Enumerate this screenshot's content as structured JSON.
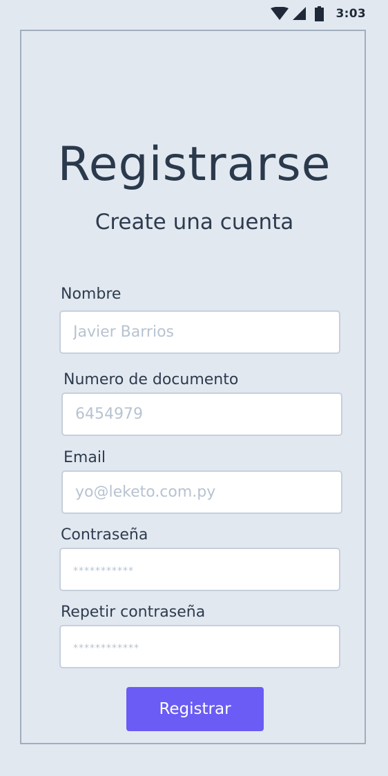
{
  "status_bar": {
    "time": "3:03",
    "icons": [
      "wifi-icon",
      "cellular-signal-icon",
      "battery-icon"
    ]
  },
  "form": {
    "title": "Registrarse",
    "subtitle": "Create una cuenta",
    "fields": [
      {
        "label": "Nombre",
        "placeholder": "Javier Barrios",
        "value": ""
      },
      {
        "label": "Numero de documento",
        "placeholder": "6454979",
        "value": ""
      },
      {
        "label": "Email",
        "placeholder": "yo@leketo.com.py",
        "value": ""
      },
      {
        "label": "Contraseña",
        "placeholder": "***********",
        "value": ""
      },
      {
        "label": "Repetir contraseña",
        "placeholder": "************",
        "value": ""
      }
    ],
    "submit_label": "Registrar"
  },
  "colors": {
    "background": "#e2e8f0",
    "frame_border": "#a0adbc",
    "text": "#2d3b4e",
    "placeholder": "#b7c3d1",
    "accent": "#6a5cf4"
  }
}
